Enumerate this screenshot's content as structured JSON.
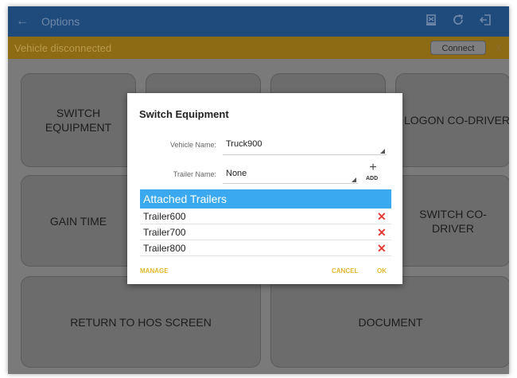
{
  "appbar": {
    "back_icon": "arrow-left-icon",
    "title": "Options"
  },
  "status": {
    "message": "Vehicle disconnected",
    "connect_label": "Connect",
    "close_label": "X"
  },
  "tiles": {
    "switch_equipment": "SWITCH EQUIPMENT",
    "logon_codriver": "LOGON CO-DRIVER",
    "gain_time": "GAIN TIME",
    "switch_codriver": "SWITCH CO-DRIVER",
    "return_hos": "RETURN TO HOS SCREEN",
    "document": "DOCUMENT"
  },
  "dialog": {
    "title": "Switch Equipment",
    "vehicle_label": "Vehicle Name:",
    "vehicle_value": "Truck900",
    "trailer_label": "Trailer Name:",
    "trailer_value": "None",
    "add_plus": "+",
    "add_label": "ADD",
    "attached_header": "Attached Trailers",
    "trailers": [
      {
        "name": "Trailer600"
      },
      {
        "name": "Trailer700"
      },
      {
        "name": "Trailer800"
      }
    ],
    "delete_glyph": "✕",
    "manage_label": "MANAGE",
    "cancel_label": "CANCEL",
    "ok_label": "OK"
  },
  "colors": {
    "appbar": "#1f4a7c",
    "statusbar": "#8c6b14",
    "header_blue": "#3aa9ef",
    "action_yellow": "#e0b830",
    "delete_red": "#e53935"
  }
}
